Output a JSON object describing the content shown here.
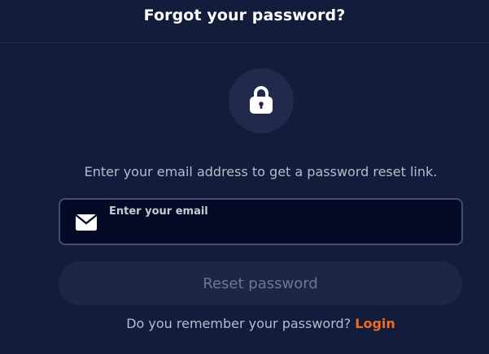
{
  "header": {
    "title": "Forgot your password?"
  },
  "icons": {
    "lock": "lock-icon",
    "mail": "mail-icon"
  },
  "form": {
    "description": "Enter your email address to get a password reset link.",
    "email_placeholder": "Enter your email",
    "email_value": "",
    "reset_button_label": "Reset password"
  },
  "footer": {
    "prompt": "Do you remember your password?",
    "login_label": "Login"
  },
  "colors": {
    "background": "#141c3c",
    "input_background": "#050b26",
    "accent": "#f26a1c",
    "button_disabled": "#1e2644"
  }
}
